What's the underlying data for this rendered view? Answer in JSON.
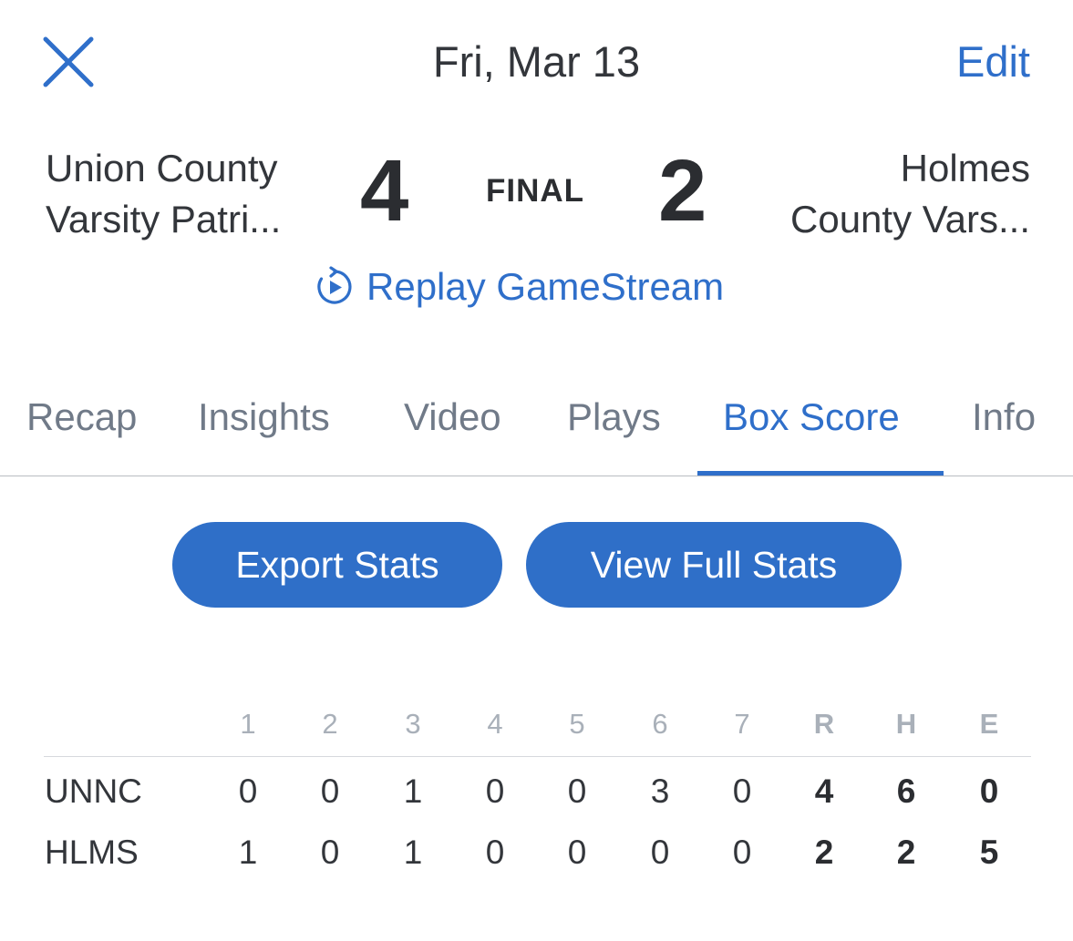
{
  "header": {
    "date": "Fri, Mar 13",
    "edit_label": "Edit"
  },
  "game": {
    "home_team_line1": "Union County",
    "home_team_line2": "Varsity Patri...",
    "home_score": "4",
    "status": "FINAL",
    "away_score": "2",
    "away_team_line1": "Holmes",
    "away_team_line2": "County Vars...",
    "replay_label": "Replay GameStream"
  },
  "tabs": [
    {
      "label": "Recap",
      "active": false
    },
    {
      "label": "Insights",
      "active": false
    },
    {
      "label": "Video",
      "active": false
    },
    {
      "label": "Plays",
      "active": false
    },
    {
      "label": "Box Score",
      "active": true
    },
    {
      "label": "Info",
      "active": false
    }
  ],
  "actions": {
    "export_label": "Export Stats",
    "view_full_label": "View Full Stats"
  },
  "boxscore": {
    "columns": [
      "1",
      "2",
      "3",
      "4",
      "5",
      "6",
      "7",
      "R",
      "H",
      "E"
    ],
    "rows": [
      {
        "team": "UNNC",
        "values": [
          "0",
          "0",
          "1",
          "0",
          "0",
          "3",
          "0",
          "4",
          "6",
          "0"
        ]
      },
      {
        "team": "HLMS",
        "values": [
          "1",
          "0",
          "1",
          "0",
          "0",
          "0",
          "0",
          "2",
          "2",
          "5"
        ]
      }
    ]
  },
  "colors": {
    "accent": "#2f6fca",
    "text": "#33363b",
    "muted": "#707a88"
  },
  "icons": {
    "close": "close-icon",
    "replay": "replay-icon"
  }
}
